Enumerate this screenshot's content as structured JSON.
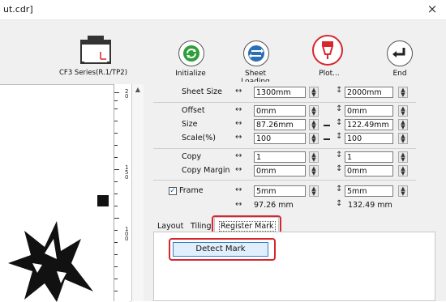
{
  "window": {
    "title": "ut.cdr]",
    "close_label": "×"
  },
  "device": {
    "name": "CF3 Series(R.1/TP2)"
  },
  "toolbar": {
    "buttons": [
      {
        "label": "Initialize"
      },
      {
        "label": "Sheet Loading"
      },
      {
        "label": "Plot..."
      },
      {
        "label": "End"
      }
    ]
  },
  "ruler": {
    "label_a": "2\n0",
    "label_b": "1\n5\n0",
    "label_c": "1\n0\n0"
  },
  "properties": {
    "sheet_size": {
      "label": "Sheet Size",
      "width": "1300mm",
      "height": "2000mm"
    },
    "offset": {
      "label": "Offset",
      "x": "0mm",
      "y": "0mm"
    },
    "size": {
      "label": "Size",
      "width": "87.26mm",
      "height": "122.49mm"
    },
    "scale": {
      "label": "Scale(%)",
      "x": "100",
      "y": "100"
    },
    "copy": {
      "label": "Copy",
      "x": "1",
      "y": "1"
    },
    "copy_margin": {
      "label": "Copy Margin",
      "x": "0mm",
      "y": "0mm"
    },
    "frame": {
      "label": "Frame",
      "checked": true,
      "check_mark": "✓",
      "x": "5mm",
      "y": "5mm"
    },
    "totals": {
      "width": "97.26 mm",
      "height": "132.49 mm"
    }
  },
  "tabs": [
    {
      "label": "Layout"
    },
    {
      "label": "Tiling"
    },
    {
      "label": "Register Mark"
    }
  ],
  "register_panel": {
    "detect_button": "Detect Mark"
  },
  "colors": {
    "highlight": "#d7262e",
    "accent_green": "#2e9e3a",
    "accent_blue": "#2b6fb6",
    "accent_red": "#d7262e"
  }
}
